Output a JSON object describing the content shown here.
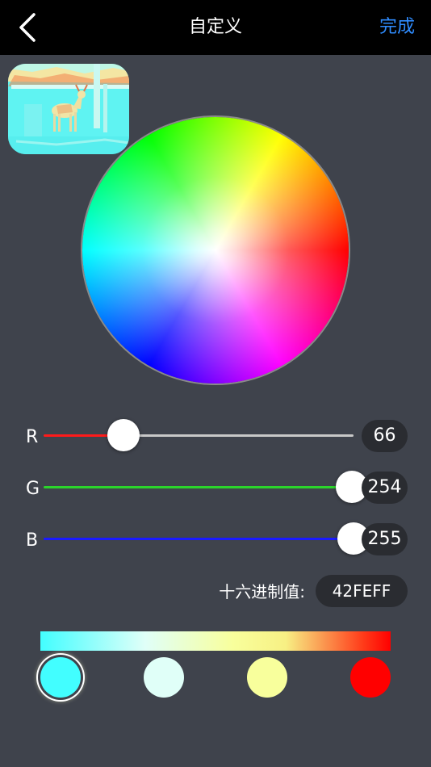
{
  "nav": {
    "title": "自定义",
    "done_label": "完成",
    "back_icon": "chevron-left-icon"
  },
  "preview_image": {
    "name": "deer-preview-image"
  },
  "color_wheel": {
    "name": "color-wheel"
  },
  "sliders": [
    {
      "label": "R",
      "value": "66",
      "fraction": 0.259,
      "track_color": "#ff1a1a"
    },
    {
      "label": "G",
      "value": "254",
      "fraction": 0.996,
      "track_color": "#2bd52b"
    },
    {
      "label": "B",
      "value": "255",
      "fraction": 1.0,
      "track_color": "#1a1aff"
    }
  ],
  "hex": {
    "label": "十六进制值:",
    "value": "42FEFF"
  },
  "gradient": {
    "stops": [
      "#42feff",
      "#e0fff8",
      "#f8ff9c",
      "#ff0000"
    ]
  },
  "swatches": [
    {
      "color": "#42feff",
      "selected": true
    },
    {
      "color": "#e0fff8",
      "selected": false
    },
    {
      "color": "#f8ff9c",
      "selected": false
    },
    {
      "color": "#ff0000",
      "selected": false
    }
  ]
}
